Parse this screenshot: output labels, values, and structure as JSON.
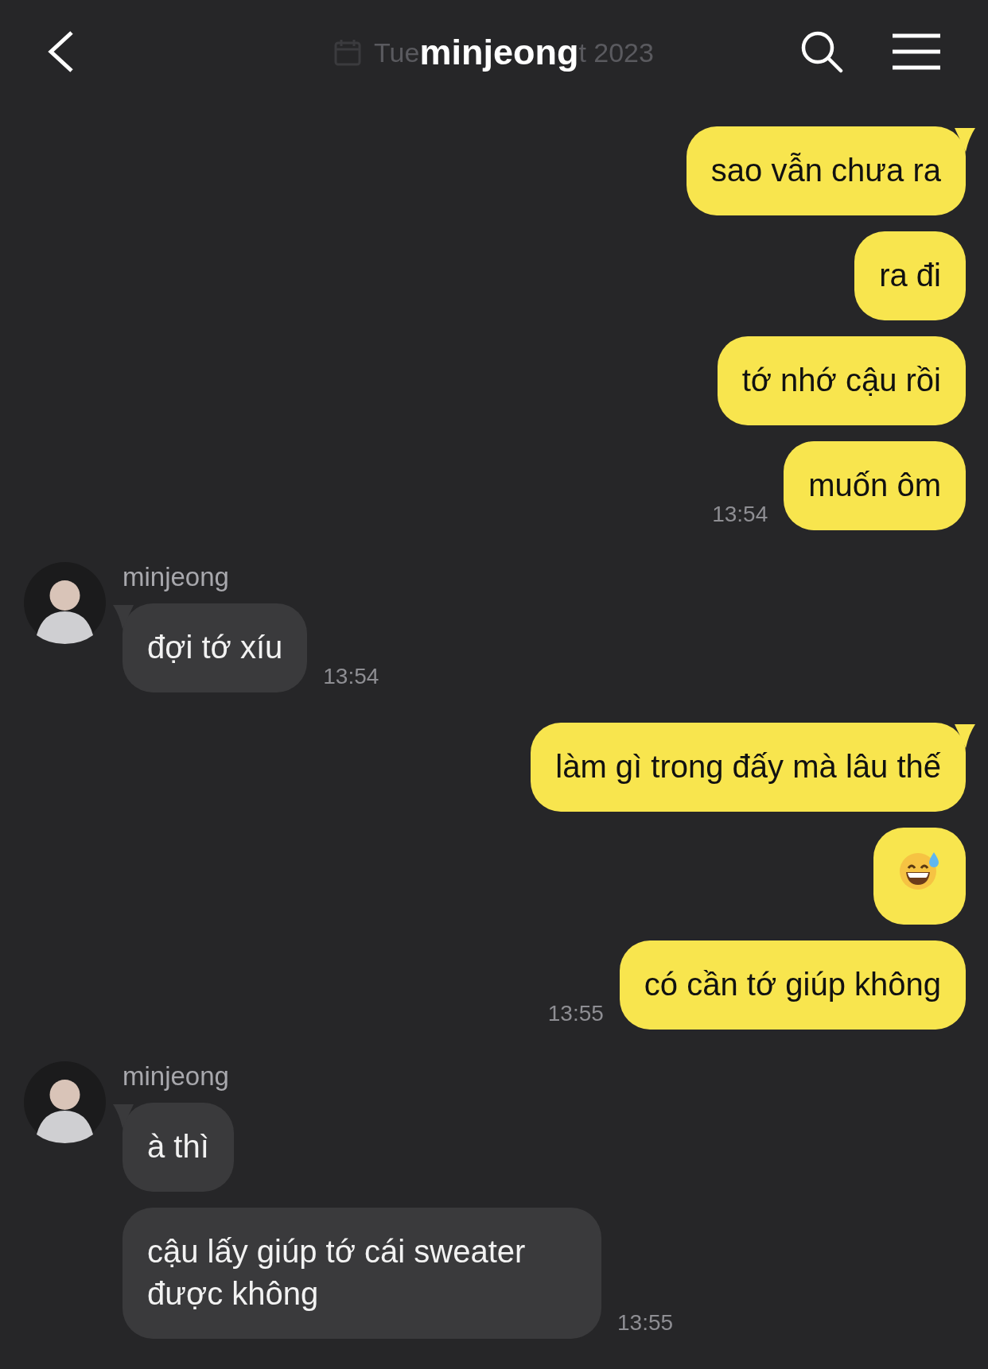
{
  "header": {
    "title": "minjeong",
    "date_left": "Tue",
    "date_right": "t 2023"
  },
  "groups": [
    {
      "kind": "sent",
      "time": "13:54",
      "messages": [
        {
          "kind": "text",
          "text": "sao vẫn chưa ra"
        },
        {
          "kind": "text",
          "text": "ra đi"
        },
        {
          "kind": "text",
          "text": "tớ nhớ cậu rồi"
        },
        {
          "kind": "text",
          "text": "muốn ôm"
        }
      ]
    },
    {
      "kind": "received",
      "name": "minjeong",
      "time": "13:54",
      "messages": [
        {
          "kind": "text",
          "text": "đợi tớ xíu"
        }
      ]
    },
    {
      "kind": "sent",
      "time": "13:55",
      "messages": [
        {
          "kind": "text",
          "text": "làm gì trong đấy mà lâu thế"
        },
        {
          "kind": "emoji"
        },
        {
          "kind": "text",
          "text": "có cần tớ giúp không"
        }
      ]
    },
    {
      "kind": "received",
      "name": "minjeong",
      "time": "13:55",
      "messages": [
        {
          "kind": "text",
          "text": "à thì"
        },
        {
          "kind": "text",
          "text": "cậu lấy giúp tớ cái sweater được không"
        }
      ]
    }
  ]
}
